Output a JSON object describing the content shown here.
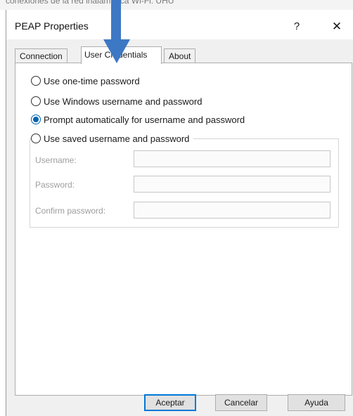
{
  "background_window": {
    "title_fragment": "conexiones de la red inalámbrica Wi-Fi: UHU"
  },
  "dialog": {
    "title": "PEAP Properties",
    "help_glyph": "?",
    "close_glyph": "✕"
  },
  "tabs": [
    {
      "label": "Connection",
      "active": false
    },
    {
      "label": "User Credentials",
      "active": true
    },
    {
      "label": "About",
      "active": false
    }
  ],
  "options": [
    {
      "label": "Use one-time password",
      "checked": false
    },
    {
      "label": "Use Windows username and password",
      "checked": false
    },
    {
      "label": "Prompt automatically for username and password",
      "checked": true
    },
    {
      "label": "Use saved username and password",
      "checked": false
    }
  ],
  "fields": {
    "username": {
      "label": "Username:",
      "value": ""
    },
    "password": {
      "label": "Password:",
      "value": ""
    },
    "confirm_password": {
      "label": "Confirm password:",
      "value": ""
    }
  },
  "buttons": {
    "ok": "Aceptar",
    "cancel": "Cancelar",
    "help": "Ayuda"
  },
  "colors": {
    "accent": "#0078d7",
    "annotation_arrow": "#3d78c4"
  },
  "annotation": {
    "icon": "arrow-down-icon"
  }
}
